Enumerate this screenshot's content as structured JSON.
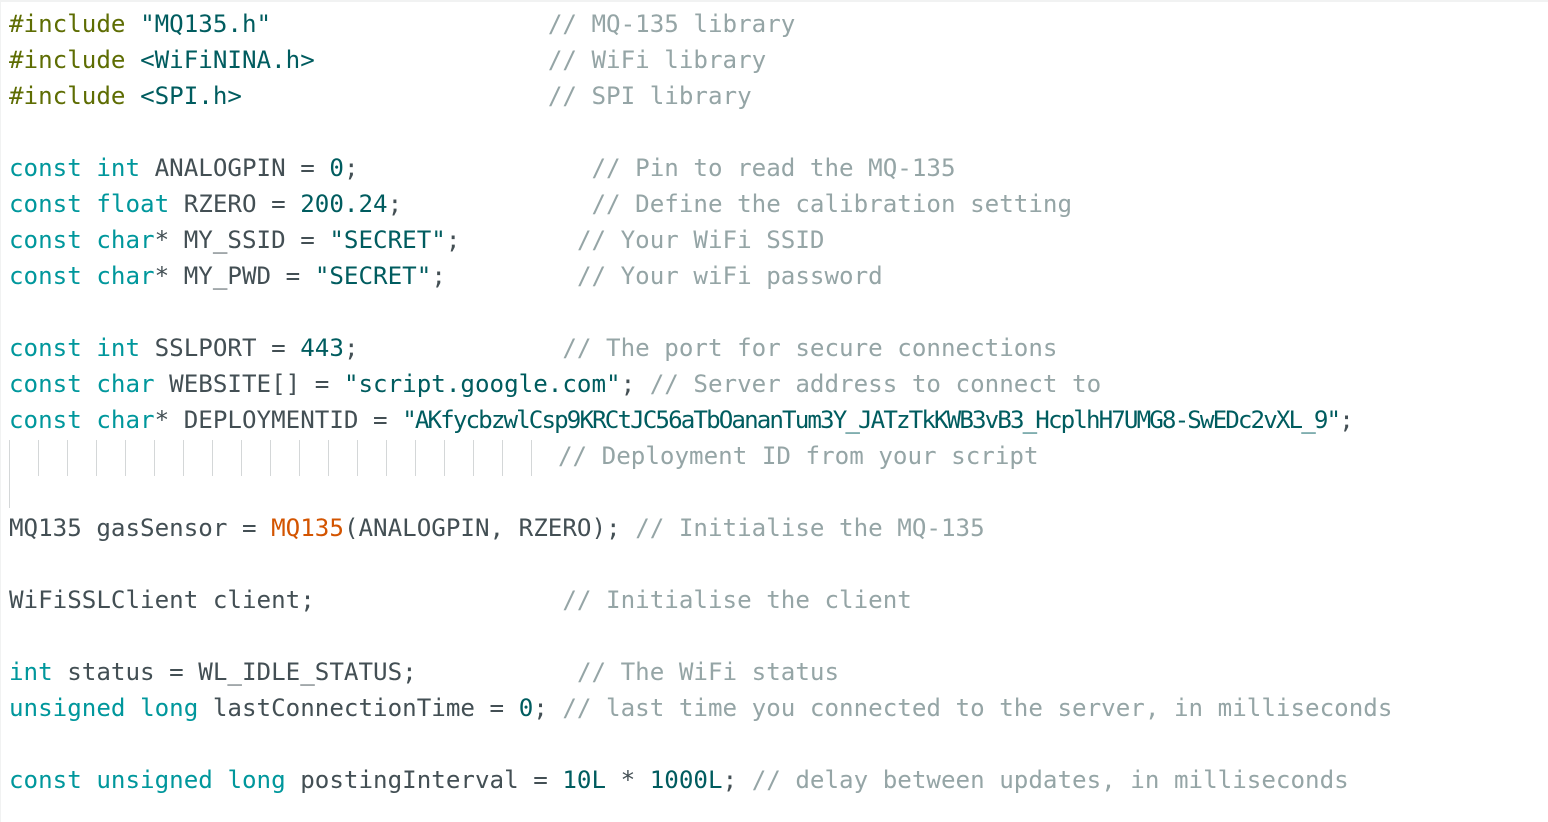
{
  "code": {
    "l1": {
      "a": "#include",
      "b": " ",
      "c": "\"MQ135.h\"",
      "d": "                   ",
      "e": "// MQ-135 library"
    },
    "l2": {
      "a": "#include",
      "b": " ",
      "c": "<WiFiNINA.h>",
      "d": "                ",
      "e": "// WiFi library"
    },
    "l3": {
      "a": "#include",
      "b": " ",
      "c": "<SPI.h>",
      "d": "                     ",
      "e": "// SPI library"
    },
    "l5": {
      "a": "const",
      "b": " ",
      "c": "int",
      "d": " ANALOGPIN = ",
      "f": "0",
      "g": ";                ",
      "e": "// Pin to read the MQ-135"
    },
    "l6": {
      "a": "const",
      "b": " ",
      "c": "float",
      "d": " RZERO = ",
      "f": "200.24",
      "g": ";             ",
      "e": "// Define the calibration setting"
    },
    "l7": {
      "a": "const",
      "b": " ",
      "c": "char",
      "d": "* MY_SSID = ",
      "f": "\"SECRET\"",
      "g": ";        ",
      "e": "// Your WiFi SSID"
    },
    "l8": {
      "a": "const",
      "b": " ",
      "c": "char",
      "d": "* MY_PWD = ",
      "f": "\"SECRET\"",
      "g": ";         ",
      "e": "// Your wiFi password"
    },
    "l10": {
      "a": "const",
      "b": " ",
      "c": "int",
      "d": " SSLPORT = ",
      "f": "443",
      "g": ";              ",
      "e": "// The port for secure connections"
    },
    "l11": {
      "a": "const",
      "b": " ",
      "c": "char",
      "d": " WEBSITE[] = ",
      "f": "\"script.google.com\"",
      "g": "; ",
      "e": "// Server address to connect to"
    },
    "l12": {
      "a": "const",
      "b": " ",
      "c": "char",
      "d": "* DEPLOYMENTID = ",
      "f": "\"AKfycbzwlCsp9KRCtJC56aTbOananTum3Y_JATzTkKWB3vB3_HcplhH7UMG8-SwEDc2vXL_9\"",
      "g": ";"
    },
    "l13": {
      "e": "// Deployment ID from your script"
    },
    "l15": {
      "a": "MQ135 gasSensor = ",
      "c": "MQ135",
      "d": "(ANALOGPIN, RZERO); ",
      "e": "// Initialise the MQ-135"
    },
    "l17": {
      "a": "WiFiSSLClient client;                 ",
      "e": "// Initialise the client"
    },
    "l19": {
      "a": "int",
      "d": " status = WL_IDLE_STATUS;           ",
      "e": "// The WiFi status"
    },
    "l20": {
      "a": "unsigned",
      "b": " ",
      "c": "long",
      "d": " lastConnectionTime = ",
      "f": "0",
      "g": "; ",
      "e": "// last time you connected to the server, in milliseconds"
    },
    "l22": {
      "a": "const",
      "b": " ",
      "c": "unsigned",
      "h": " ",
      "i": "long",
      "d": " postingInterval = ",
      "f": "10L",
      "g": " * ",
      "j": "1000L",
      "k": "; ",
      "e": "// delay between updates, in milliseconds"
    }
  },
  "colors": {
    "preprocessor": "#5e6d03",
    "keyword": "#00979c",
    "string": "#005c5f",
    "number": "#005c5f",
    "function": "#d35400",
    "comment": "#95a5a6",
    "text": "#434f54"
  }
}
